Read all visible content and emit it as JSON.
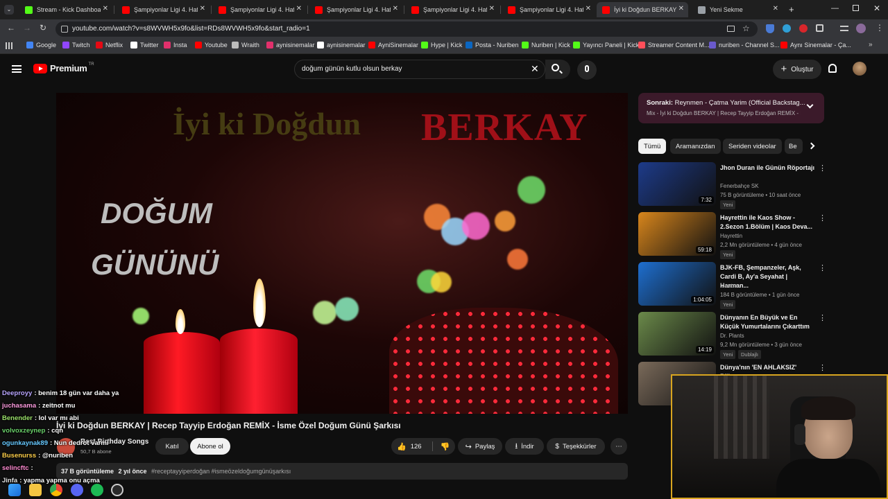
{
  "browser": {
    "tabs": [
      {
        "label": "Stream - Kick Dashboard",
        "color": "#53fc18"
      },
      {
        "label": "Şampiyonlar Ligi 4. Hafta",
        "color": "#ff0000"
      },
      {
        "label": "Şampiyonlar Ligi 4. Hafta",
        "color": "#ff0000"
      },
      {
        "label": "Şampiyonlar Ligi 4. Hafta",
        "color": "#ff0000"
      },
      {
        "label": "Şampiyonlar Ligi 4. Hafta",
        "color": "#ff0000"
      },
      {
        "label": "Şampiyonlar Ligi 4. Hafta",
        "color": "#ff0000"
      },
      {
        "label": "İyi ki Doğdun BERKAY",
        "color": "#ff0000",
        "active": true
      },
      {
        "label": "Yeni Sekme",
        "color": "#9aa0a6"
      }
    ],
    "url": "youtube.com/watch?v=s8WVWH5x9fo&list=RDs8WVWH5x9fo&start_radio=1",
    "bookmarks": [
      {
        "label": "Google",
        "color": "#4285f4"
      },
      {
        "label": "Twitch",
        "color": "#9146ff"
      },
      {
        "label": "Netflix",
        "color": "#e50914"
      },
      {
        "label": "Twitter",
        "color": "#ffffff"
      },
      {
        "label": "Insta",
        "color": "#e1306c"
      },
      {
        "label": "Youtube",
        "color": "#ff0000"
      },
      {
        "label": "Wraith",
        "color": "#bbbbbb"
      },
      {
        "label": "aynisinemalar",
        "color": "#e1306c"
      },
      {
        "label": "aynisinemalar",
        "color": "#ffffff"
      },
      {
        "label": "AyniSinemalar",
        "color": "#ff0000"
      },
      {
        "label": "Hype | Kick",
        "color": "#53fc18"
      },
      {
        "label": "Posta - Nuriben",
        "color": "#0a66c2"
      },
      {
        "label": "Nuriben | Kick",
        "color": "#53fc18"
      },
      {
        "label": "Yayıncı Paneli | Kick",
        "color": "#53fc18"
      },
      {
        "label": "Streamer Content M...",
        "color": "#ff4f5a"
      },
      {
        "label": "nuriben - Channel S...",
        "color": "#6a5acd"
      },
      {
        "label": "Aynı Sinemalar - Ça...",
        "color": "#ff0000"
      }
    ]
  },
  "youtube": {
    "logo": "Premium",
    "logo_sup": "TR",
    "search_query": "doğum günün kutlu olsun berkay",
    "create_label": "Oluştur",
    "up_next": {
      "prefix": "Sonraki:",
      "title": "Reynmen - Çatma Yarim (Official Backstag...",
      "subtitle": "Mix - İyi ki Doğdun BERKAY | Recep Tayyip Erdoğan REMİX - İ..."
    },
    "chips": [
      "Tümü",
      "Aramanızdan",
      "Seriden videolar",
      "Be"
    ],
    "recommendations": [
      {
        "title": "Jhon Duran ile Günün Röportajı",
        "channel": "Fenerbahçe SK",
        "meta": "75 B görüntüleme • 10 saat önce",
        "badge": "Yeni",
        "duration": "7:32",
        "thumb": "#1d3b8a"
      },
      {
        "title": "Hayrettin ile Kaos Show - 2.Sezon 1.Bölüm | Kaos Deva...",
        "channel": "Hayrettin",
        "meta": "2,2 Mn görüntüleme • 4 gün önce",
        "badge": "Yeni",
        "duration": "59:18",
        "thumb": "#d8861c"
      },
      {
        "title": "BJK-FB, Şempanzeler, Aşk, Cardi B, Ay'a Seyahat | Harman...",
        "channel": "Mantra",
        "meta": "184 B görüntüleme • 1 gün önce",
        "badge": "Yeni",
        "duration": "1:04:05",
        "thumb": "#1e6fd0"
      },
      {
        "title": "Dünyanın En Büyük ve En Küçük Yumurtalarını Çıkarttım",
        "channel": "Dr. Plants",
        "meta": "9,2 Mn görüntüleme • 3 gün önce",
        "badge": "Yeni",
        "badge2": "Dublajlı",
        "duration": "14:19",
        "thumb": "#6b8a4a"
      },
      {
        "title": "Dünya'nın 'EN AHLAKSIZ' Bilinen",
        "channel": "",
        "meta": "",
        "badge": "",
        "duration": "",
        "thumb": "#7a6a5a"
      }
    ],
    "video": {
      "overlay_top_left": "İyi ki Doğdun",
      "overlay_top_right": "BERKAY",
      "overlay_left_1": "DOĞUM",
      "overlay_left_2": "GÜNÜNÜ",
      "title": "İyi ki Doğdun BERKAY | Recep Tayyip Erdoğan REMİX - İsme Özel Doğum Günü Şarkısı",
      "channel": "Best Birthday Songs",
      "subscribers": "50,7 B abone",
      "join_label": "Katıl",
      "subscribe_label": "Abone ol",
      "likes": "126",
      "share_label": "Paylaş",
      "download_label": "İndir",
      "thanks_label": "Teşekkürler",
      "views": "37 B görüntüleme",
      "age": "2 yıl önce",
      "tags": "#receptayyiperdoğan #ismeözeldoğumgünüşarkısı"
    }
  },
  "chat": [
    {
      "user": "Deeproyy",
      "msg": ": benim 18 gün var daha ya",
      "color": "#b9a6ff"
    },
    {
      "user": "juchasama",
      "msg": ": zeitnot mu",
      "color": "#ff9ce0"
    },
    {
      "user": "Benender",
      "msg": ": lol var mı abi",
      "color": "#9be26b"
    },
    {
      "user": "volvoxzeynep",
      "msg": ": cqn",
      "color": "#6bd36b"
    },
    {
      "user": "ogunkaynak89",
      "msg": ": Nun dedrot varmi",
      "color": "#66c8ff"
    },
    {
      "user": "Busenurss",
      "msg": ": @nuriben",
      "color": "#ffcf4a"
    },
    {
      "user": "selincftc",
      "msg": ":",
      "color": "#ff8ad0"
    },
    {
      "user": "Jinfa",
      "msg": ": yapma yapma onu açma",
      "color": "#e0e0e0"
    }
  ]
}
